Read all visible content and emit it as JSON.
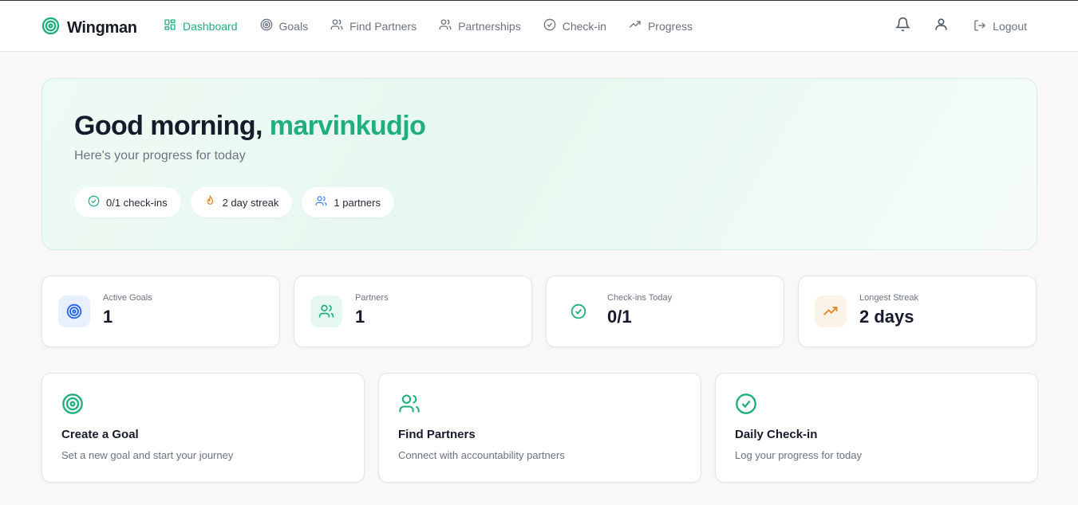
{
  "brand": {
    "name": "Wingman"
  },
  "nav": [
    {
      "label": "Dashboard",
      "icon": "grid-icon",
      "active": true
    },
    {
      "label": "Goals",
      "icon": "target-icon"
    },
    {
      "label": "Find Partners",
      "icon": "users-icon"
    },
    {
      "label": "Partnerships",
      "icon": "users-icon"
    },
    {
      "label": "Check-in",
      "icon": "check-circle-icon"
    },
    {
      "label": "Progress",
      "icon": "trending-up-icon"
    }
  ],
  "header_actions": {
    "logout_label": "Logout"
  },
  "hero": {
    "greeting": "Good morning,",
    "username": "marvinkudjo",
    "subtitle": "Here's your progress for today",
    "pills": [
      {
        "label": "0/1 check-ins",
        "icon": "check-circle-icon",
        "color": "#1fae7d"
      },
      {
        "label": "2 day streak",
        "icon": "flame-icon",
        "color": "#e0872b"
      },
      {
        "label": "1 partners",
        "icon": "users-icon",
        "color": "#3b82f6"
      }
    ]
  },
  "stats": [
    {
      "label": "Active Goals",
      "value": "1",
      "icon": "target-icon",
      "color": "#2563eb",
      "bg": "#e8f0fd"
    },
    {
      "label": "Partners",
      "value": "1",
      "icon": "users-icon",
      "color": "#1fae7d",
      "bg": "#e5f7ef"
    },
    {
      "label": "Check-ins Today",
      "value": "0/1",
      "icon": "check-circle-icon",
      "color": "#1fae7d",
      "bg": "#ffffff"
    },
    {
      "label": "Longest Streak",
      "value": "2 days",
      "icon": "trending-up-icon",
      "color": "#e0872b",
      "bg": "#fbf3e8"
    }
  ],
  "actions": [
    {
      "title": "Create a Goal",
      "desc": "Set a new goal and start your journey",
      "icon": "target-icon"
    },
    {
      "title": "Find Partners",
      "desc": "Connect with accountability partners",
      "icon": "users-icon"
    },
    {
      "title": "Daily Check-in",
      "desc": "Log your progress for today",
      "icon": "check-circle-icon"
    }
  ],
  "colors": {
    "accent": "#1fae7d",
    "text": "#151b2b",
    "muted": "#6b7280"
  }
}
